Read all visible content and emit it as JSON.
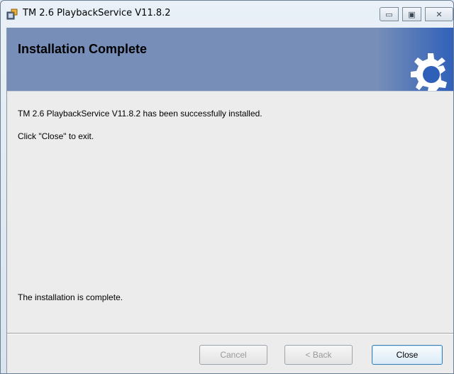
{
  "window": {
    "title": "TM 2.6 PlaybackService V11.8.2",
    "controls": {
      "minimize": "▭",
      "maximize": "▣",
      "close": "✕"
    }
  },
  "banner": {
    "title": "Installation Complete",
    "art": "gear-icon",
    "color": "#768eb8"
  },
  "body": {
    "line1": "TM 2.6 PlaybackService V11.8.2 has been successfully installed.",
    "line2": "Click \"Close\" to exit.",
    "footer_text": "The installation is complete."
  },
  "buttons": {
    "cancel": "Cancel",
    "back": "< Back",
    "close": "Close"
  }
}
